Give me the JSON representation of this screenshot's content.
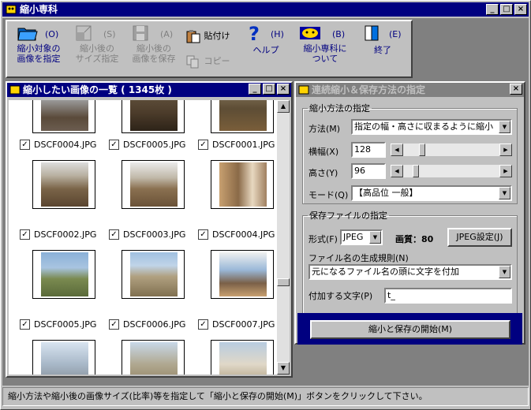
{
  "app": {
    "title": "縮小専科"
  },
  "window_buttons": {
    "minimize": "_",
    "maximize": "□",
    "close": "×"
  },
  "toolbar": [
    {
      "key": "(O)",
      "label": "縮小対象の\n画像を指定",
      "icon": "open-folder-icon",
      "enabled": true
    },
    {
      "key": "(S)",
      "label": "縮小後の\nサイズ指定",
      "icon": "resize-icon",
      "enabled": false
    },
    {
      "key": "(A)",
      "label": "縮小後の\n画像を保存",
      "icon": "save-disk-icon",
      "enabled": false
    },
    {
      "key": "",
      "label": "貼付け",
      "icon": "paste-icon",
      "enabled": true
    },
    {
      "key": "",
      "label": "コピー",
      "icon": "copy-icon",
      "enabled": false
    },
    {
      "key": "(H)",
      "label": "ヘルプ",
      "icon": "help-icon",
      "enabled": true
    },
    {
      "key": "(B)",
      "label": "縮小専科に\nついて",
      "icon": "about-icon",
      "enabled": true
    },
    {
      "key": "(E)",
      "label": "終了",
      "icon": "exit-door-icon",
      "enabled": true
    }
  ],
  "list_window": {
    "title": "縮小したい画像の一覧 ( 1345枚 )",
    "rows": [
      [
        "DSCF0004.JPG",
        "DSCF0005.JPG",
        "DSCF0001.JPG"
      ],
      [
        "DSCF0002.JPG",
        "DSCF0003.JPG",
        "DSCF0004.JPG"
      ],
      [
        "DSCF0005.JPG",
        "DSCF0006.JPG",
        "DSCF0007.JPG"
      ]
    ],
    "checkmark": "✓"
  },
  "settings_window": {
    "title": "連続縮小＆保存方法の指定",
    "shrink_group": "縮小方法の指定",
    "method_label": "方法(M)",
    "method_value": "指定の幅・高さに収まるように縮小",
    "width_label": "横幅(X)",
    "width_value": "128",
    "height_label": "高さ(Y)",
    "height_value": "96",
    "mode_label": "モード(Q)",
    "mode_value": "【高品位 一般】",
    "save_group": "保存ファイルの指定",
    "format_label": "形式(F)",
    "format_value": "JPEG",
    "quality_text": "画質：80",
    "jpeg_button": "JPEG設定(J)",
    "rule_label": "ファイル名の生成規則(N)",
    "rule_value": "元になるファイル名の頭に文字を付加",
    "append_label": "付加する文字(P)",
    "append_value": "t_",
    "start_button": "縮小と保存の開始(M)"
  },
  "status": "縮小方法や縮小後の画像サイズ(比率)等を指定して「縮小と保存の開始(M)」ボタンをクリックして下さい。"
}
